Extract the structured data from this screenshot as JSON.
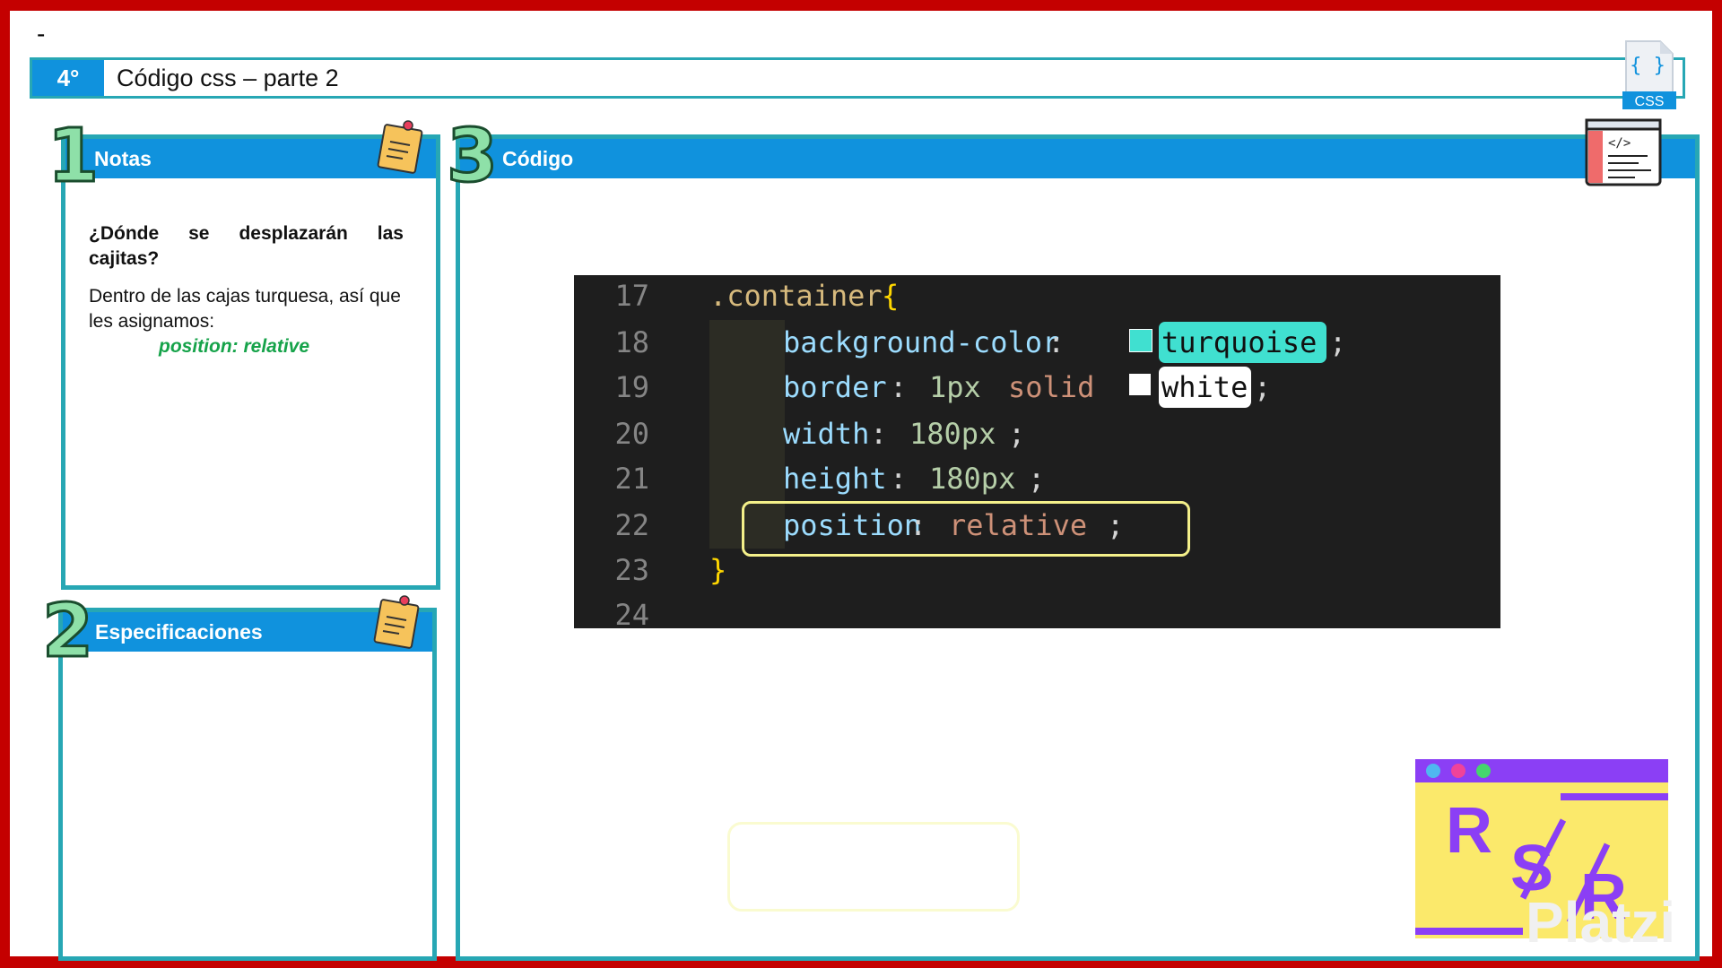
{
  "header": {
    "dash": "-",
    "step_number": "4°",
    "title": "Código css – parte 2",
    "file_icon_label": "CSS",
    "file_icon_braces": "{ }"
  },
  "panels": {
    "notas": {
      "number": "1",
      "title": "Notas",
      "question": "¿Dónde se desplazarán las cajitas?",
      "answer": "Dentro de las cajas turquesa, así que les asignamos:",
      "highlight": "position: relative"
    },
    "especificaciones": {
      "number": "2",
      "title": "Especificaciones"
    },
    "codigo": {
      "number": "3",
      "title": "Código"
    }
  },
  "code": {
    "line_numbers": [
      "17",
      "18",
      "19",
      "20",
      "21",
      "22",
      "23",
      "24"
    ],
    "line17": {
      "selector": ".container",
      "brace": "{"
    },
    "line18": {
      "prop": "background-color",
      "colon": ": ",
      "value": "turquoise",
      "semi": ";"
    },
    "line19": {
      "prop": "border",
      "colon": ": ",
      "num": "1px",
      "kw": "solid",
      "value": "white",
      "semi": ";"
    },
    "line20": {
      "prop": "width",
      "colon": ": ",
      "value": "180px",
      "semi": ";"
    },
    "line21": {
      "prop": "height",
      "colon": ": ",
      "value": "180px",
      "semi": ";"
    },
    "line22": {
      "prop": "position",
      "colon": ": ",
      "value": "relative",
      "semi": ";"
    },
    "line23": {
      "brace": "}"
    }
  },
  "logo": {
    "letters": [
      "R",
      "S",
      "R"
    ],
    "watermark": "Platzi"
  },
  "colors": {
    "frame": "#c40000",
    "accent_blue": "#1092dd",
    "panel_border": "#27a7b4",
    "code_bg": "#1e1e1e",
    "turquoise": "#40e0d0",
    "highlight_yellow": "#f4f08a",
    "green_text": "#16a34a"
  }
}
